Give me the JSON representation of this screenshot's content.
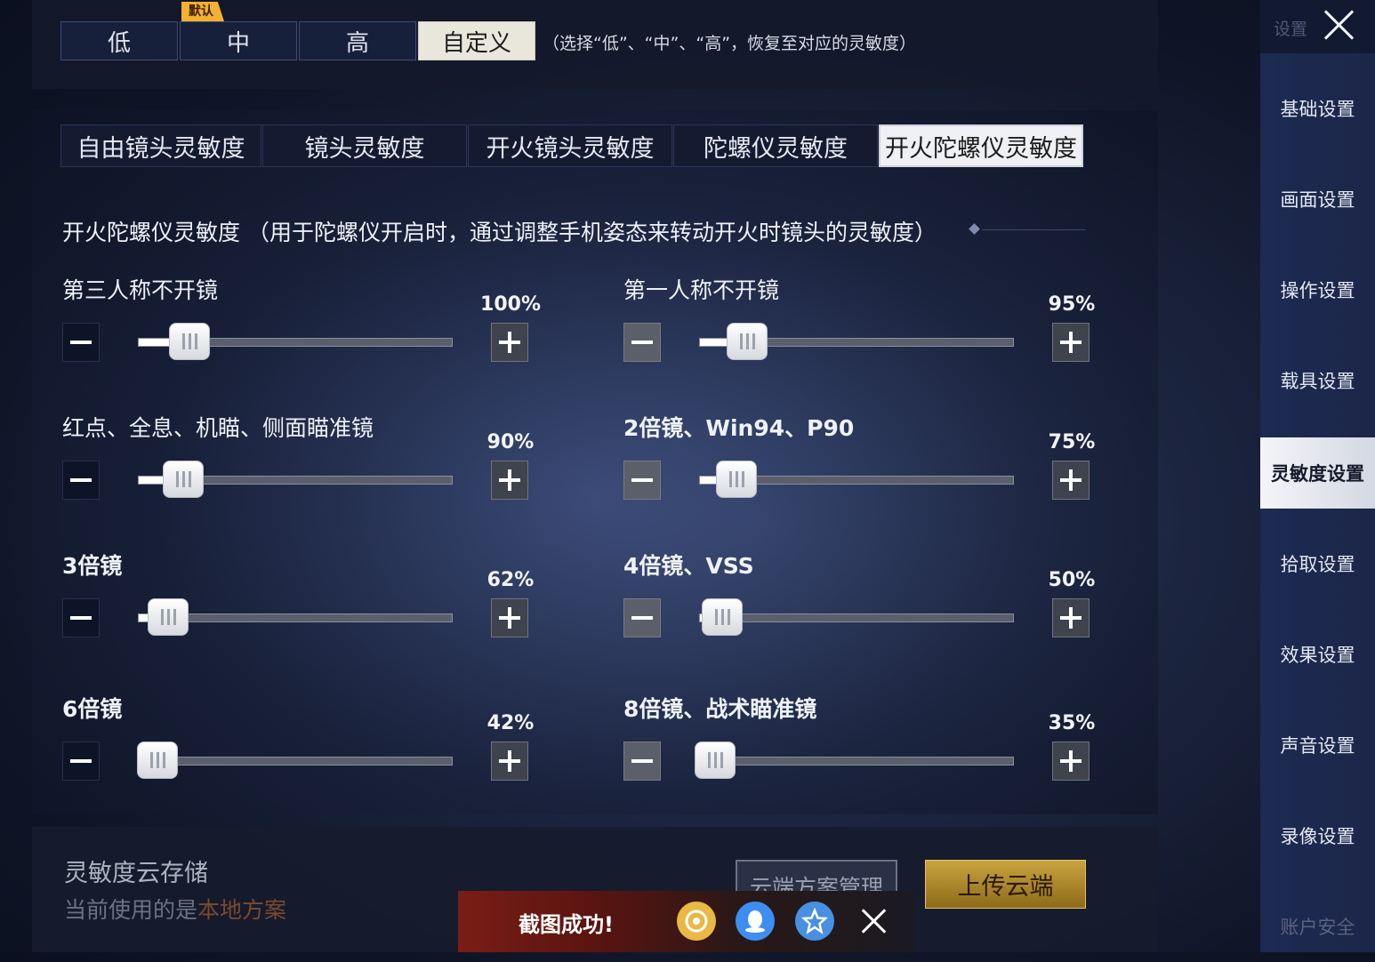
{
  "presets": {
    "default_badge": "默认",
    "items": [
      "低",
      "中",
      "高",
      "自定义"
    ],
    "active_index": 3,
    "hint": "（选择“低”、“中”、“高”，恢复至对应的灵敏度）"
  },
  "tabs": {
    "items": [
      "自由镜头灵敏度",
      "镜头灵敏度",
      "开火镜头灵敏度",
      "陀螺仪灵敏度",
      "开火陀螺仪灵敏度"
    ],
    "active_index": 4
  },
  "section_title": "开火陀螺仪灵敏度 （用于陀螺仪开启时，通过调整手机姿态来转动开火时镜头的灵敏度）",
  "sliders": [
    {
      "label": "第三人称不开镜",
      "value": "100%"
    },
    {
      "label": "第一人称不开镜",
      "value": "95%"
    },
    {
      "label": "红点、全息、机瞄、侧面瞄准镜",
      "value": "90%"
    },
    {
      "label": "2倍镜、Win94、P90",
      "value": "75%"
    },
    {
      "label": "3倍镜",
      "value": "62%"
    },
    {
      "label": "4倍镜、VSS",
      "value": "50%"
    },
    {
      "label": "6倍镜",
      "value": "42%"
    },
    {
      "label": "8倍镜、战术瞄准镜",
      "value": "35%"
    }
  ],
  "cloud": {
    "title": "灵敏度云存储",
    "subtitle_prefix": "当前使用的是",
    "subtitle_highlight": "本地方案",
    "manage_label": "云端方案管理",
    "upload_label": "上传云端"
  },
  "toast": {
    "text": "截图成功!",
    "icons": [
      "gamecenter-icon",
      "qq-icon",
      "qzone-icon"
    ]
  },
  "sidebar": {
    "title": "设置",
    "items": [
      "基础设置",
      "画面设置",
      "操作设置",
      "载具设置",
      "灵敏度设置",
      "拾取设置",
      "效果设置",
      "声音设置",
      "录像设置",
      "账户安全"
    ],
    "active_index": 4
  },
  "colors": {
    "accent_gold": "#c9a43f",
    "badge_orange": "#f4b030",
    "active_tab": "#eef0f3"
  }
}
